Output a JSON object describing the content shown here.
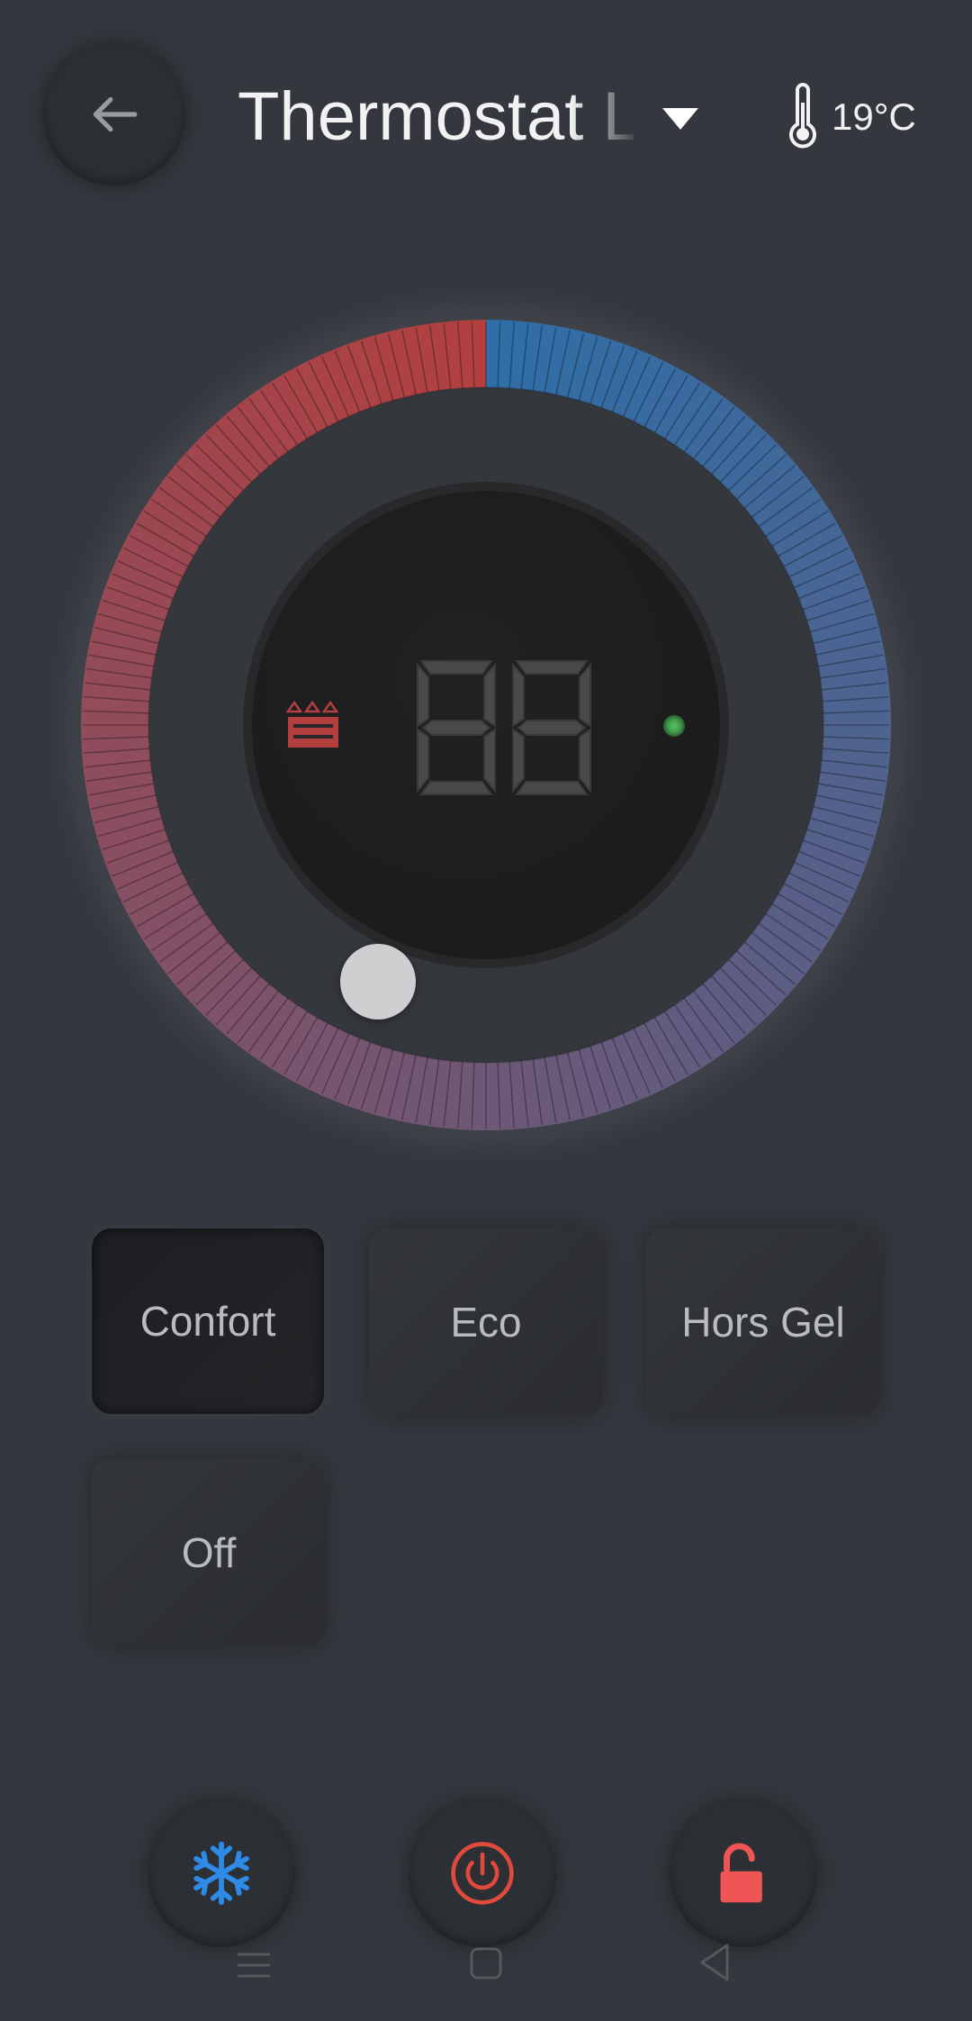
{
  "header": {
    "title": "Thermostat Lab",
    "external_temperature": "19°C"
  },
  "dial": {
    "setpoint_display": "88",
    "heat_color": "#b3403f",
    "cool_color": "#2f6ea8",
    "low_color": "#6e5877",
    "status_led_color": "#4caf50",
    "heater_icon": "radiator-icon"
  },
  "modes": [
    {
      "label": "Confort",
      "active": true
    },
    {
      "label": "Eco",
      "active": false
    },
    {
      "label": "Hors Gel",
      "active": false
    },
    {
      "label": "Off",
      "active": false
    }
  ],
  "actions": {
    "frost_icon": "snowflake-icon",
    "power_icon": "power-icon",
    "lock_icon": "unlock-icon",
    "frost_color": "#2d8ae6",
    "power_color": "#e04a3c",
    "lock_color": "#f05555"
  },
  "navbar": {
    "icons": [
      "menu-icon",
      "home-icon",
      "back-icon"
    ]
  }
}
